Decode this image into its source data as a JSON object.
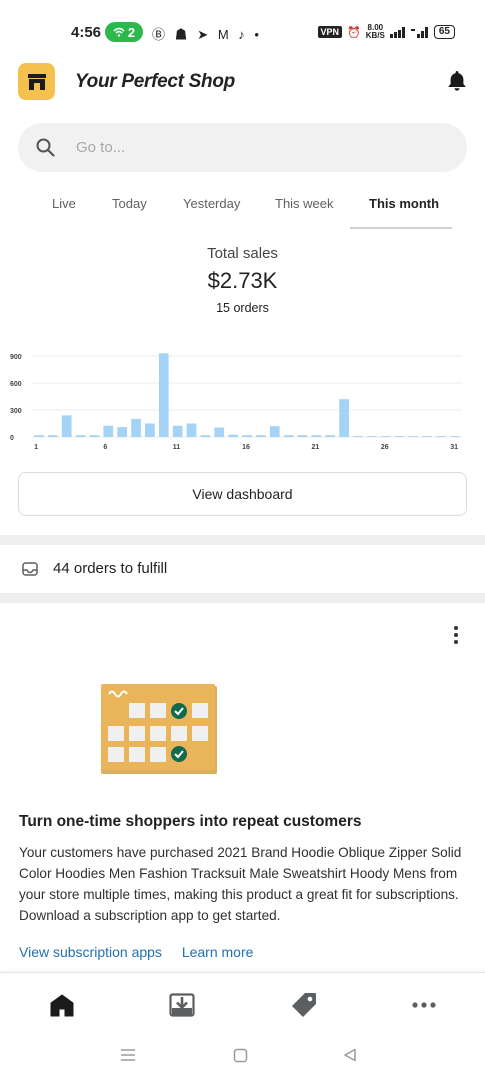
{
  "status_bar": {
    "time": "4:56",
    "hotspot_count": "2",
    "vpn": "VPN",
    "speed_value": "8.00",
    "speed_unit": "KB/S",
    "battery": "65"
  },
  "header": {
    "shop_name": "Your Perfect Shop",
    "colors": {
      "logo_bg": "#f4c04e"
    }
  },
  "search": {
    "placeholder": "Go to..."
  },
  "tabs": [
    {
      "label": "Live"
    },
    {
      "label": "Today"
    },
    {
      "label": "Yesterday"
    },
    {
      "label": "This week"
    },
    {
      "label": "This month",
      "active": true
    }
  ],
  "summary": {
    "total_label": "Total sales",
    "total_value": "$2.73K",
    "orders": "15 orders"
  },
  "chart_data": {
    "type": "bar",
    "y_ticks": [
      "900",
      "600",
      "300",
      "0"
    ],
    "ylim": [
      0,
      900
    ],
    "x_tick_labels": [
      "1",
      "6",
      "11",
      "16",
      "21",
      "26",
      "31"
    ],
    "categories": [
      1,
      2,
      3,
      4,
      5,
      6,
      7,
      8,
      9,
      10,
      11,
      12,
      13,
      14,
      15,
      16,
      17,
      18,
      19,
      20,
      21,
      22,
      23,
      24,
      25,
      26,
      27,
      28,
      29,
      30,
      31
    ],
    "values": [
      20,
      20,
      240,
      20,
      20,
      125,
      110,
      200,
      150,
      930,
      125,
      150,
      20,
      105,
      25,
      20,
      20,
      120,
      20,
      20,
      20,
      20,
      420,
      10,
      10,
      10,
      10,
      10,
      10,
      10,
      10
    ],
    "grid": true,
    "bar_color": "#a4d3f6"
  },
  "actions": {
    "view_dashboard": "View dashboard"
  },
  "fulfill": {
    "text": "44 orders to fulfill"
  },
  "card": {
    "title": "Turn one-time shoppers into repeat customers",
    "body": "Your customers have purchased 2021 Brand Hoodie Oblique Zipper Solid Color Hoodies Men Fashion Tracksuit Male Sweatshirt Hoody Mens from your store multiple times, making this product a great fit for subscriptions. Download a subscription app to get started.",
    "link_primary": "View subscription apps",
    "link_secondary": "Learn more"
  },
  "bottom_nav": {
    "icons": [
      "home-icon",
      "orders-icon",
      "tag-icon",
      "more-icon"
    ]
  }
}
